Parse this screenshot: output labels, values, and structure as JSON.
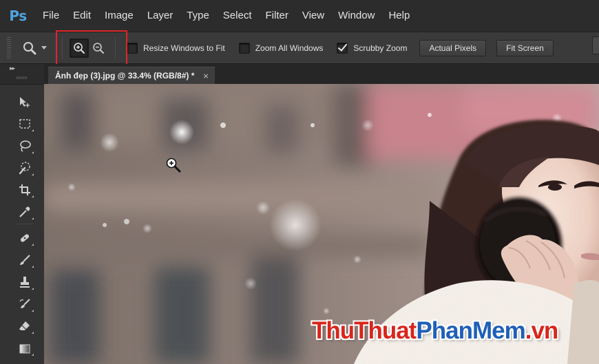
{
  "app": {
    "logo": "Ps"
  },
  "menu": [
    "File",
    "Edit",
    "Image",
    "Layer",
    "Type",
    "Select",
    "Filter",
    "View",
    "Window",
    "Help"
  ],
  "options": {
    "tool_icon": "magnifier-icon",
    "zoom_in_icon": "zoom-in-icon",
    "zoom_out_icon": "zoom-out-icon",
    "zoom_mode_selected": "zoom-in",
    "resize_windows_label": "Resize Windows to Fit",
    "resize_windows_checked": false,
    "zoom_all_label": "Zoom All Windows",
    "zoom_all_checked": false,
    "scrubby_label": "Scrubby Zoom",
    "scrubby_checked": true,
    "actual_pixels_label": "Actual Pixels",
    "fit_screen_label": "Fit Screen"
  },
  "toolbox": {
    "collapse_glyph": "▸▸",
    "tools": [
      "move-tool-icon",
      "marquee-tool-icon",
      "lasso-tool-icon",
      "quick-selection-tool-icon",
      "crop-tool-icon",
      "eyedropper-tool-icon",
      "healing-brush-tool-icon",
      "brush-tool-icon",
      "clone-stamp-tool-icon",
      "history-brush-tool-icon",
      "eraser-tool-icon",
      "gradient-tool-icon"
    ]
  },
  "document": {
    "tab_title": "Ảnh đẹp (3).jpg @ 33.4% (RGB/8#) *",
    "close_glyph": "×"
  },
  "watermark": {
    "part1": "ThuThuat",
    "part2": "PhanMem",
    "part3": ".vn"
  },
  "colors": {
    "highlight": "#e0262c",
    "ps_blue": "#4fa3e0",
    "watermark_red": "#d8261c",
    "watermark_blue": "#1f5fb8"
  }
}
